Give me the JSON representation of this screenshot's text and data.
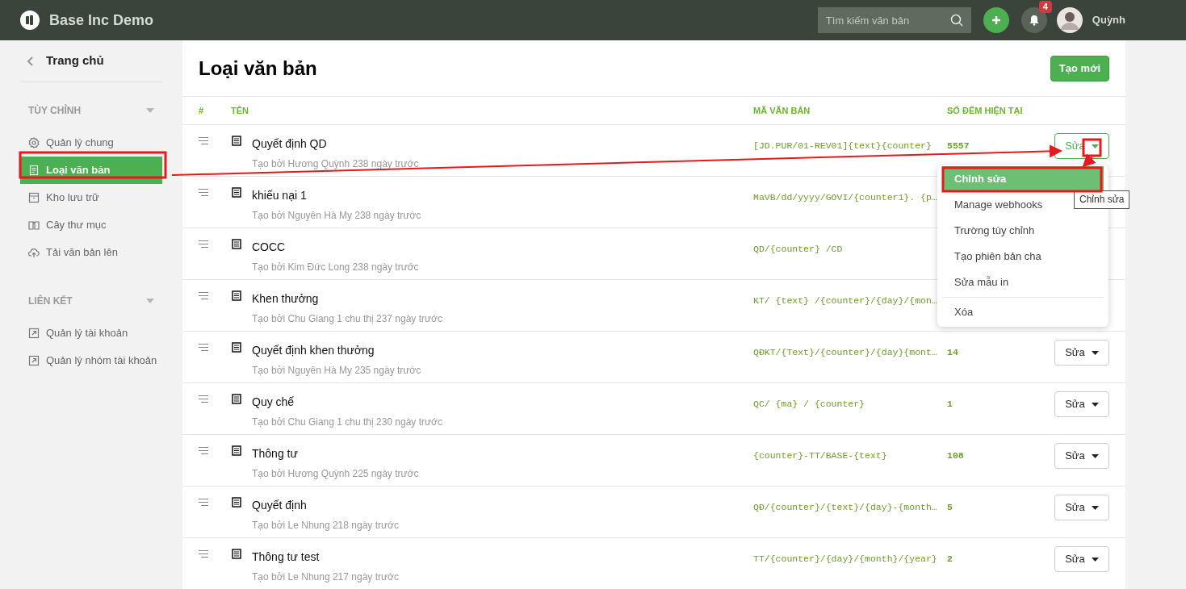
{
  "app": {
    "title": "Base Inc Demo"
  },
  "header": {
    "search_placeholder": "Tìm kiếm văn bản",
    "notification_count": "4",
    "user_name": "Quỳnh"
  },
  "sidebar": {
    "back": "Trang chủ",
    "sections": [
      {
        "title": "TÙY CHỈNH",
        "items": [
          {
            "label": "Quản lý chung",
            "selected": false
          },
          {
            "label": "Loại văn bản",
            "selected": true
          },
          {
            "label": "Kho lưu trữ",
            "selected": false
          },
          {
            "label": "Cây thư mục",
            "selected": false
          },
          {
            "label": "Tải văn bản lên",
            "selected": false
          }
        ]
      },
      {
        "title": "LIÊN KẾT",
        "items": [
          {
            "label": "Quản lý tài khoản",
            "selected": false
          },
          {
            "label": "Quản lý nhóm tài khoản",
            "selected": false
          }
        ]
      }
    ]
  },
  "page": {
    "title": "Loại văn bản",
    "create_button": "Tạo mới"
  },
  "table": {
    "columns": [
      "#",
      "TÊN",
      "MÃ VĂN BẢN",
      "SỐ ĐẾM HIỆN TẠI"
    ],
    "rows": [
      {
        "name": "Quyết định QD",
        "meta": "Tạo bởi Hương Quỳnh 238 ngày trước",
        "code": "[JD.PUR/01-REV01]{text}{counter}",
        "count": "5557",
        "action": {
          "label": "Sửa",
          "open": true
        }
      },
      {
        "name": "khiếu nại 1",
        "meta": "Tạo bởi Nguyên Hà My 238 ngày trước",
        "code": "MaVB/dd/yyyy/GOVI/{counter1}. {p…"
      },
      {
        "name": "COCC",
        "meta": "Tạo bởi Kim Đức Long 238 ngày trước",
        "code": "QD/{counter} /CD"
      },
      {
        "name": "Khen thưởng",
        "meta": "Tạo bởi Chu Giang 1 chu thị 237 ngày trước",
        "code": "KT/ {text} /{counter}/{day}/{mon…"
      },
      {
        "name": "Quyết định khen thưởng",
        "meta": "Tạo bởi Nguyên Hà My 235 ngày trước",
        "code": "QĐKT/{Text}/{counter}/{day}{mont…",
        "count": "14",
        "action": {
          "label": "Sửa",
          "open": false
        }
      },
      {
        "name": "Quy chế",
        "meta": "Tạo bởi Chu Giang 1 chu thị 230 ngày trước",
        "code": "QC/ {ma} / {counter}",
        "count": "1",
        "action": {
          "label": "Sửa",
          "open": false
        }
      },
      {
        "name": "Thông tư",
        "meta": "Tạo bởi Hương Quỳnh 225 ngày trước",
        "code": "{counter}-TT/BASE-{text}",
        "count": "108",
        "action": {
          "label": "Sửa",
          "open": false
        }
      },
      {
        "name": "Quyết định",
        "meta": "Tạo bởi Le Nhung 218 ngày trước",
        "code": "QĐ/{counter}/{text}/{day}-{month…",
        "count": "5",
        "action": {
          "label": "Sửa",
          "open": false
        }
      },
      {
        "name": "Thông tư test",
        "meta": "Tạo bởi Le Nhung 217 ngày trước",
        "code": "TT/{counter}/{day}/{month}/{year}",
        "count": "2",
        "action": {
          "label": "Sửa",
          "open": false
        }
      }
    ]
  },
  "menu": {
    "items": [
      {
        "label": "Chỉnh sửa",
        "selected": true,
        "divider_before": false
      },
      {
        "label": "Manage webhooks",
        "selected": false,
        "divider_before": false
      },
      {
        "label": "Trường tùy chỉnh",
        "selected": false,
        "divider_before": false
      },
      {
        "label": "Tạo phiên bản cha",
        "selected": false,
        "divider_before": false
      },
      {
        "label": "Sửa mẫu in",
        "selected": false,
        "divider_before": false
      },
      {
        "label": "Xóa",
        "selected": false,
        "divider_before": true
      }
    ]
  },
  "tooltip": "Chỉnh sửa"
}
